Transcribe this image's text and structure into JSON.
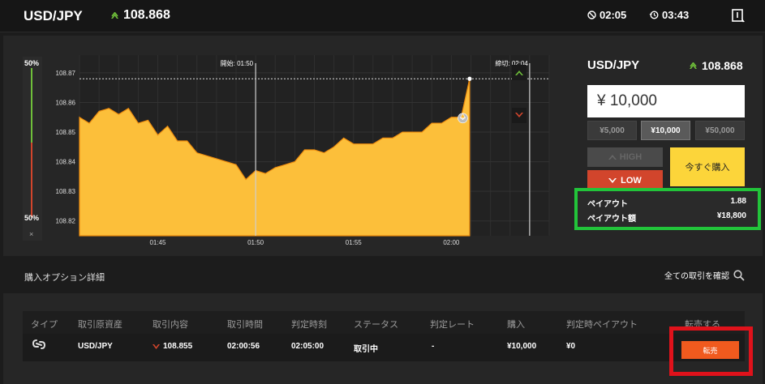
{
  "header": {
    "pair": "USD/JPY",
    "price": "108.868",
    "timer1": "02:05",
    "timer2": "03:43"
  },
  "gauge": {
    "top_label": "50%",
    "bottom_label": "50%",
    "close": "×"
  },
  "chart": {
    "start_label": "開始: 01:50",
    "end_label": "締切: 02:04"
  },
  "chart_data": {
    "type": "area",
    "title": "",
    "xlabel": "",
    "ylabel": "",
    "x_ticks": [
      "01:45",
      "01:50",
      "01:55",
      "02:00"
    ],
    "y_ticks": [
      "108.87",
      "108.86",
      "108.85",
      "108.84",
      "108.83",
      "108.82"
    ],
    "ylim": [
      108.815,
      108.876
    ],
    "x_range_minutes": [
      "01:41",
      "02:05"
    ],
    "current_price": 108.868,
    "colors": {
      "fill": "#fcbf3a",
      "line": "#ee8c0e",
      "up": "#6fbf3a",
      "down": "#d2452c"
    },
    "series": [
      {
        "x": [
          "01:41:00",
          "01:41:30",
          "01:42:00",
          "01:42:30",
          "01:43:00",
          "01:43:30",
          "01:44:00",
          "01:44:30",
          "01:45:00",
          "01:45:30",
          "01:46:00",
          "01:46:30",
          "01:47:00",
          "01:47:30",
          "01:48:00",
          "01:48:30",
          "01:49:00",
          "01:49:30",
          "01:50:00",
          "01:50:30",
          "01:51:00",
          "01:51:30",
          "01:52:00",
          "01:52:30",
          "01:53:00",
          "01:53:30",
          "01:54:00",
          "01:54:30",
          "01:55:00",
          "01:55:30",
          "01:56:00",
          "01:56:30",
          "01:57:00",
          "01:57:30",
          "01:58:00",
          "01:58:30",
          "01:59:00",
          "01:59:30",
          "02:00:00",
          "02:00:30",
          "02:00:56"
        ],
        "values": [
          108.855,
          108.853,
          108.857,
          108.858,
          108.856,
          108.858,
          108.853,
          108.854,
          108.849,
          108.852,
          108.847,
          108.847,
          108.843,
          108.842,
          108.841,
          108.84,
          108.839,
          108.834,
          108.837,
          108.836,
          108.838,
          108.839,
          108.84,
          108.844,
          108.844,
          108.843,
          108.845,
          108.848,
          108.846,
          108.846,
          108.846,
          108.848,
          108.848,
          108.85,
          108.85,
          108.85,
          108.853,
          108.853,
          108.855,
          108.855,
          108.868
        ]
      }
    ]
  },
  "panel": {
    "title": "USD/JPY",
    "price": "108.868",
    "amount": "¥ 10,000",
    "presets": [
      "¥5,000",
      "¥10,000",
      "¥50,000"
    ],
    "high_label": "HIGH",
    "low_label": "LOW",
    "buy_label": "今すぐ購入",
    "payout_label": "ペイアウト",
    "payout_value": "1.88",
    "payout_amount_label": "ペイアウト額",
    "payout_amount_value": "¥18,800"
  },
  "details": {
    "title": "購入オプション詳細",
    "view_all": "全ての取引を確認",
    "columns": [
      "タイプ",
      "取引原資産",
      "取引内容",
      "取引時間",
      "判定時刻",
      "ステータス",
      "判定レート",
      "購入",
      "判定時ペイアウト",
      "転売する"
    ],
    "row": {
      "asset": "USD/JPY",
      "content": "108.855",
      "trade_time": "02:00:56",
      "judge_time": "02:05:00",
      "status": "取引中",
      "judge_rate": "-",
      "purchase": "¥10,000",
      "payout": "¥0",
      "sell_label": "転売"
    }
  }
}
